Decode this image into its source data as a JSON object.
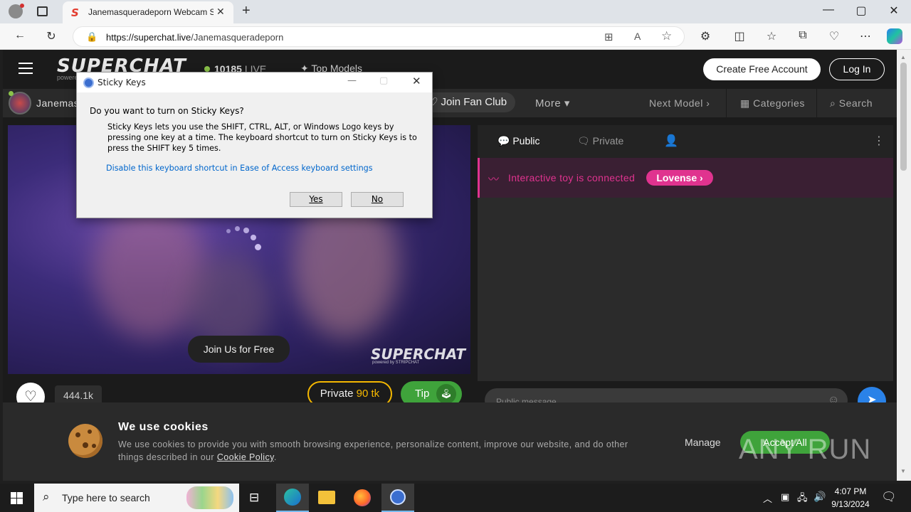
{
  "browser": {
    "tab_title": "Janemasqueradeporn Webcam S",
    "tab_favicon": "S",
    "url_host": "https://superchat.live",
    "url_path": "/Janemasqueradeporn",
    "window_controls": {
      "minimize": "—",
      "maximize": "▢",
      "close": "✕"
    }
  },
  "site": {
    "logo": "SUPERCHAT",
    "logo_sub": "powered",
    "live_count": "10185",
    "live_label": "LIVE",
    "top_models": "Top Models",
    "create_account": "Create Free Account",
    "login": "Log In",
    "model_name": "Janemas",
    "join_fan_club": "Join Fan Club",
    "more": "More",
    "next_model": "Next Model",
    "categories": "Categories",
    "search": "Search",
    "join_free": "Join Us for Free",
    "watermark": "SUPERCHAT",
    "watermark_sub": "powered by STRIPCHAT",
    "likes": "444.1k",
    "private_label": "Private",
    "private_price": "90 tk",
    "tip_label": "Tip",
    "chat_public": "Public",
    "chat_private": "Private",
    "toy_text": "Interactive toy is connected",
    "toy_brand": "Lovense",
    "message_placeholder": "Public message"
  },
  "cookie": {
    "title": "We use cookies",
    "body": "We use cookies to provide you with smooth browsing experience, personalize content, improve our website, and do other things described in our",
    "policy_link": "Cookie Policy",
    "policy_end": ".",
    "manage": "Manage",
    "accept": "Accept All"
  },
  "dialog": {
    "title": "Sticky Keys",
    "question": "Do you want to turn on Sticky Keys?",
    "description": "Sticky Keys lets you use the SHIFT, CTRL, ALT, or Windows Logo keys by pressing one key at a time. The keyboard shortcut to turn on Sticky Keys is to press the SHIFT key 5 times.",
    "link": "Disable this keyboard shortcut in Ease of Access keyboard settings",
    "yes": "Yes",
    "no": "No"
  },
  "watermark": {
    "text": "ANY RUN"
  },
  "taskbar": {
    "search_placeholder": "Type here to search",
    "time": "4:07 PM",
    "date": "9/13/2024"
  },
  "colors": {
    "accent_pink": "#e0338f",
    "live_green": "#8bc34a",
    "private_gold": "#f5b800",
    "tip_green": "#3fa33b"
  }
}
